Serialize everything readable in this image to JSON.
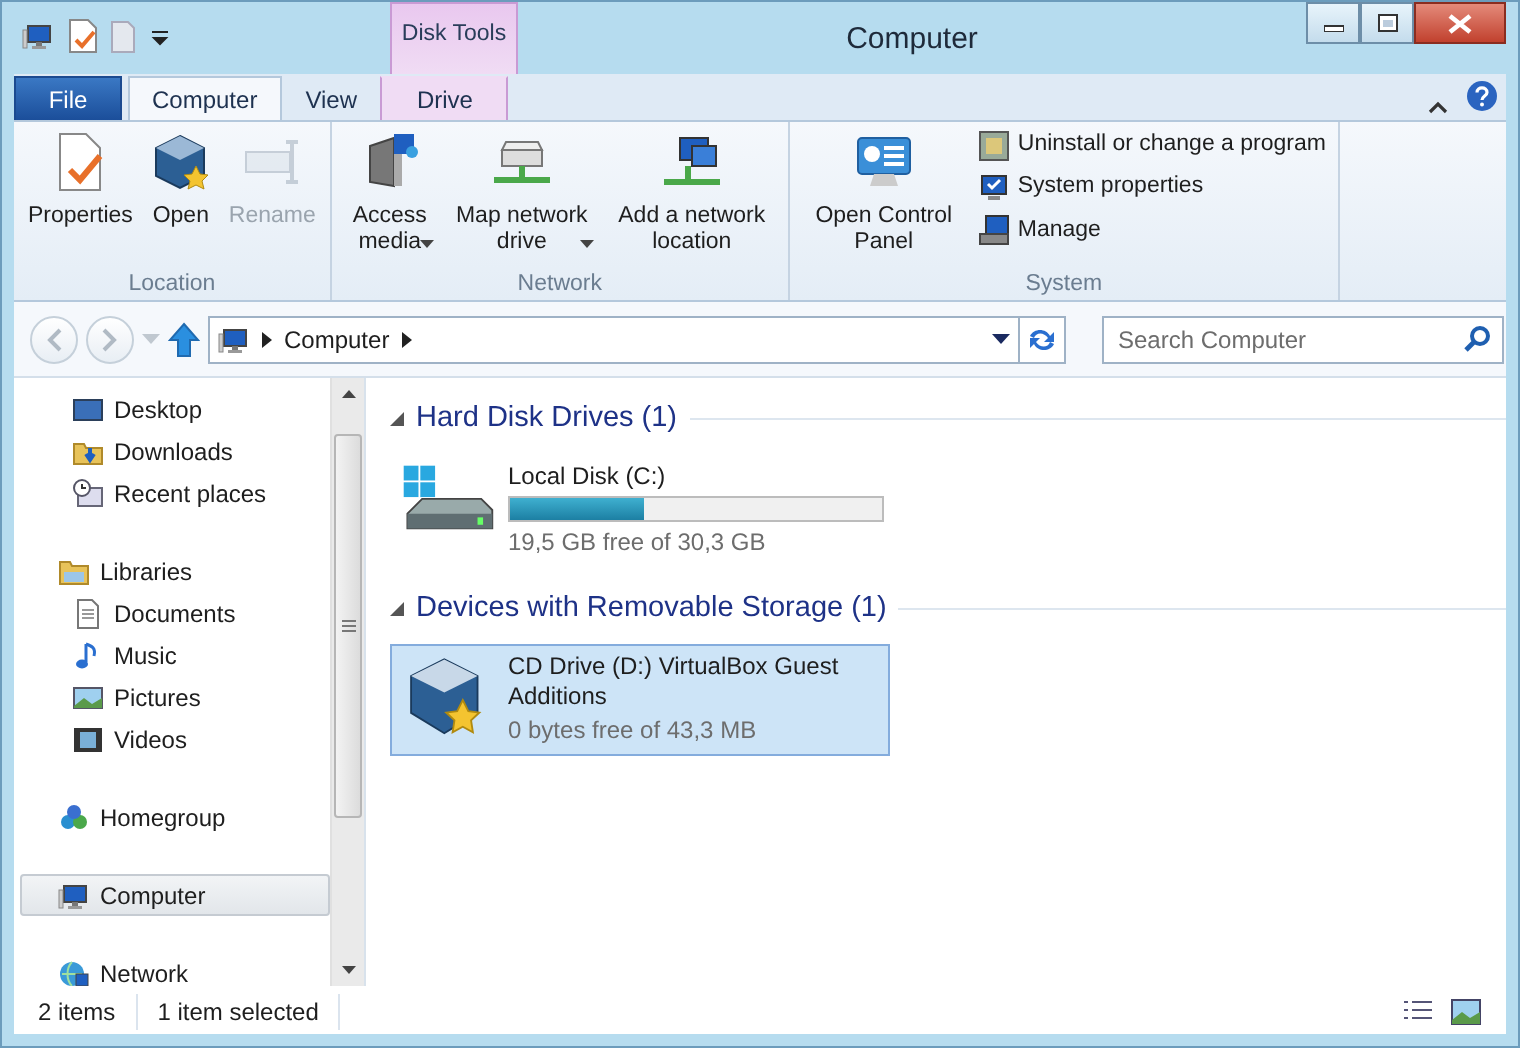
{
  "window": {
    "title": "Computer"
  },
  "contextual_group": {
    "label": "Disk Tools"
  },
  "tabs": [
    {
      "label": "File",
      "kind": "file",
      "selected": false
    },
    {
      "label": "Computer",
      "kind": "tab",
      "selected": true
    },
    {
      "label": "View",
      "kind": "tab",
      "selected": false
    },
    {
      "label": "Drive",
      "kind": "contextual",
      "selected": false
    }
  ],
  "ribbon": {
    "groups": [
      {
        "label": "Location",
        "commands": [
          {
            "label": "Properties",
            "kind": "large",
            "disabled": false,
            "dropdown": false
          },
          {
            "label": "Open",
            "kind": "large",
            "disabled": false,
            "dropdown": false
          },
          {
            "label": "Rename",
            "kind": "large",
            "disabled": true,
            "dropdown": false
          }
        ]
      },
      {
        "label": "Network",
        "commands": [
          {
            "label": "Access media",
            "kind": "large",
            "disabled": false,
            "dropdown": true
          },
          {
            "label": "Map network drive",
            "kind": "large",
            "disabled": false,
            "dropdown": true
          },
          {
            "label": "Add a network location",
            "kind": "large",
            "disabled": false,
            "dropdown": false
          }
        ]
      },
      {
        "label": "System",
        "commands": [
          {
            "label": "Open Control Panel",
            "kind": "large",
            "disabled": false,
            "dropdown": false
          },
          {
            "label": "Uninstall or change a program",
            "kind": "small",
            "disabled": false
          },
          {
            "label": "System properties",
            "kind": "small",
            "disabled": false
          },
          {
            "label": "Manage",
            "kind": "small",
            "disabled": false
          }
        ]
      }
    ]
  },
  "address": {
    "crumbs": [
      "Computer"
    ]
  },
  "search": {
    "placeholder": "Search Computer"
  },
  "nav": {
    "sections": [
      {
        "children": [
          {
            "label": "Desktop",
            "selected": false
          },
          {
            "label": "Downloads",
            "selected": false
          },
          {
            "label": "Recent places",
            "selected": false
          }
        ]
      },
      {
        "label": "Libraries",
        "selected": false,
        "children": [
          {
            "label": "Documents",
            "selected": false
          },
          {
            "label": "Music",
            "selected": false
          },
          {
            "label": "Pictures",
            "selected": false
          },
          {
            "label": "Videos",
            "selected": false
          }
        ]
      },
      {
        "label": "Homegroup",
        "selected": false
      },
      {
        "label": "Computer",
        "selected": true
      },
      {
        "label": "Network",
        "selected": false
      }
    ]
  },
  "content": {
    "groups": [
      {
        "title": "Hard Disk Drives (1)",
        "expanded": true,
        "items": [
          {
            "name": "Local Disk (C:)",
            "level": 0.36,
            "detail": "19,5 GB free of 30,3 GB",
            "selected": false
          }
        ]
      },
      {
        "title": "Devices with Removable Storage (1)",
        "expanded": true,
        "items": [
          {
            "name": "CD Drive (D:) VirtualBox Guest Additions",
            "detail": "0 bytes free of 43,3 MB",
            "selected": true
          }
        ]
      }
    ]
  },
  "status_bar": [
    "2 items",
    "1 item selected"
  ]
}
